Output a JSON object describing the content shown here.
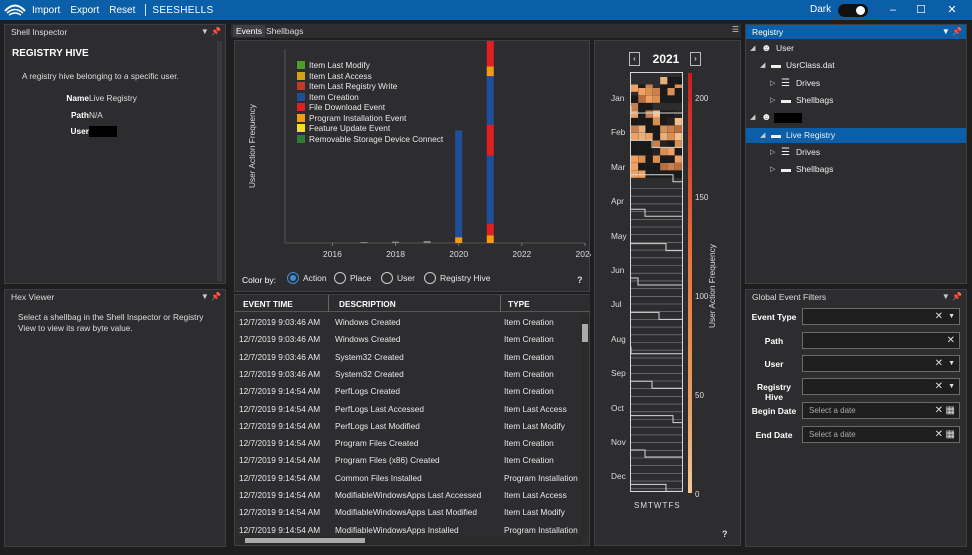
{
  "app": {
    "menu": [
      "Import",
      "Export",
      "Reset"
    ],
    "brand": "SEESHELLS",
    "theme_label": "Dark"
  },
  "shell_inspector": {
    "title": "Shell Inspector",
    "heading": "REGISTRY HIVE",
    "desc": "A registry hive belonging to a specific user.",
    "fields": [
      {
        "label": "Name",
        "value": "Live Registry"
      },
      {
        "label": "Path",
        "value": "N/A"
      },
      {
        "label": "User",
        "value": ""
      }
    ]
  },
  "hex_viewer": {
    "title": "Hex Viewer",
    "message": "Select a shellbag in the Shell Inspector or Registry View to view its raw byte value."
  },
  "tabs": [
    "Events",
    "Shellbags"
  ],
  "histogram": {
    "ylabel": "User Action Frequency",
    "legend": [
      {
        "label": "Item Last Modify",
        "color": "#4e9a2a"
      },
      {
        "label": "Item Last Access",
        "color": "#d4a017"
      },
      {
        "label": "Item Last Registry Write",
        "color": "#c0392b"
      },
      {
        "label": "Item Creation",
        "color": "#1f4e9c"
      },
      {
        "label": "File Download Event",
        "color": "#e02020"
      },
      {
        "label": "Program Installation Event",
        "color": "#f39c12"
      },
      {
        "label": "Feature Update Event",
        "color": "#f1e40f"
      },
      {
        "label": "Removable Storage Device Connect",
        "color": "#2e7d32"
      }
    ],
    "xticks": [
      "2016",
      "2018",
      "2020",
      "2022",
      "2024"
    ],
    "color_by_label": "Color by:",
    "color_by_options": [
      "Action",
      "Place",
      "User",
      "Registry Hive"
    ],
    "help": "?"
  },
  "chart_data": {
    "type": "bar",
    "series": [
      {
        "label": "Item Creation",
        "x": [
          2020,
          2021
        ],
        "values": [
          60,
          100
        ]
      },
      {
        "label": "File Download Event",
        "x": [
          2021
        ],
        "values": [
          12
        ]
      }
    ]
  },
  "events_table": {
    "columns": [
      "EVENT TIME",
      "DESCRIPTION",
      "TYPE"
    ],
    "rows": [
      [
        "12/7/2019 9:03:46 AM",
        "Windows Created",
        "Item Creation"
      ],
      [
        "12/7/2019 9:03:46 AM",
        "Windows Created",
        "Item Creation"
      ],
      [
        "12/7/2019 9:03:46 AM",
        "System32 Created",
        "Item Creation"
      ],
      [
        "12/7/2019 9:03:46 AM",
        "System32 Created",
        "Item Creation"
      ],
      [
        "12/7/2019 9:14:54 AM",
        "PerfLogs Created",
        "Item Creation"
      ],
      [
        "12/7/2019 9:14:54 AM",
        "PerfLogs Last Accessed",
        "Item Last Access"
      ],
      [
        "12/7/2019 9:14:54 AM",
        "PerfLogs Last Modified",
        "Item Last Modify"
      ],
      [
        "12/7/2019 9:14:54 AM",
        "Program Files Created",
        "Item Creation"
      ],
      [
        "12/7/2019 9:14:54 AM",
        "Program Files (x86) Created",
        "Item Creation"
      ],
      [
        "12/7/2019 9:14:54 AM",
        "Common Files Installed",
        "Program Installation"
      ],
      [
        "12/7/2019 9:14:54 AM",
        "ModifiableWindowsApps Last Accessed",
        "Item Last Access"
      ],
      [
        "12/7/2019 9:14:54 AM",
        "ModifiableWindowsApps Last Modified",
        "Item Last Modify"
      ],
      [
        "12/7/2019 9:14:54 AM",
        "ModifiableWindowsApps Installed",
        "Program Installation"
      ]
    ]
  },
  "calendar": {
    "year": "2021",
    "months": [
      "Jan",
      "Feb",
      "Mar",
      "Apr",
      "May",
      "Jun",
      "Jul",
      "Aug",
      "Sep",
      "Oct",
      "Nov",
      "Dec"
    ],
    "weekdays": "SMTWTFS",
    "scale_label": "User Action Frequency",
    "scale_ticks": [
      "200",
      "150",
      "100",
      "50",
      "0"
    ],
    "help": "?"
  },
  "registry": {
    "title": "Registry",
    "tree": [
      {
        "label": "User",
        "level": 0,
        "icon": "user-icon"
      },
      {
        "label": "UsrClass.dat",
        "level": 1,
        "icon": "folder-icon"
      },
      {
        "label": "Drives",
        "level": 2,
        "icon": "drive-icon"
      },
      {
        "label": "Shellbags",
        "level": 2,
        "icon": "folder-icon"
      },
      {
        "label": "",
        "level": 0,
        "icon": "user-icon"
      },
      {
        "label": "Live Registry",
        "level": 1,
        "icon": "folder-icon"
      },
      {
        "label": "Drives",
        "level": 2,
        "icon": "drive-icon"
      },
      {
        "label": "Shellbags",
        "level": 2,
        "icon": "folder-icon"
      }
    ]
  },
  "filters": {
    "title": "Global Event Filters",
    "items": [
      {
        "label": "Event Type",
        "placeholder": "",
        "x": true,
        "dd": true
      },
      {
        "label": "Path",
        "placeholder": "",
        "x": true,
        "dd": false
      },
      {
        "label": "User",
        "placeholder": "",
        "x": true,
        "dd": true
      },
      {
        "label": "Registry Hive",
        "placeholder": "",
        "x": true,
        "dd": true
      },
      {
        "label": "Begin Date",
        "placeholder": "Select a date",
        "x": true,
        "dd": false
      },
      {
        "label": "End Date",
        "placeholder": "Select a date",
        "x": true,
        "dd": false
      }
    ]
  }
}
